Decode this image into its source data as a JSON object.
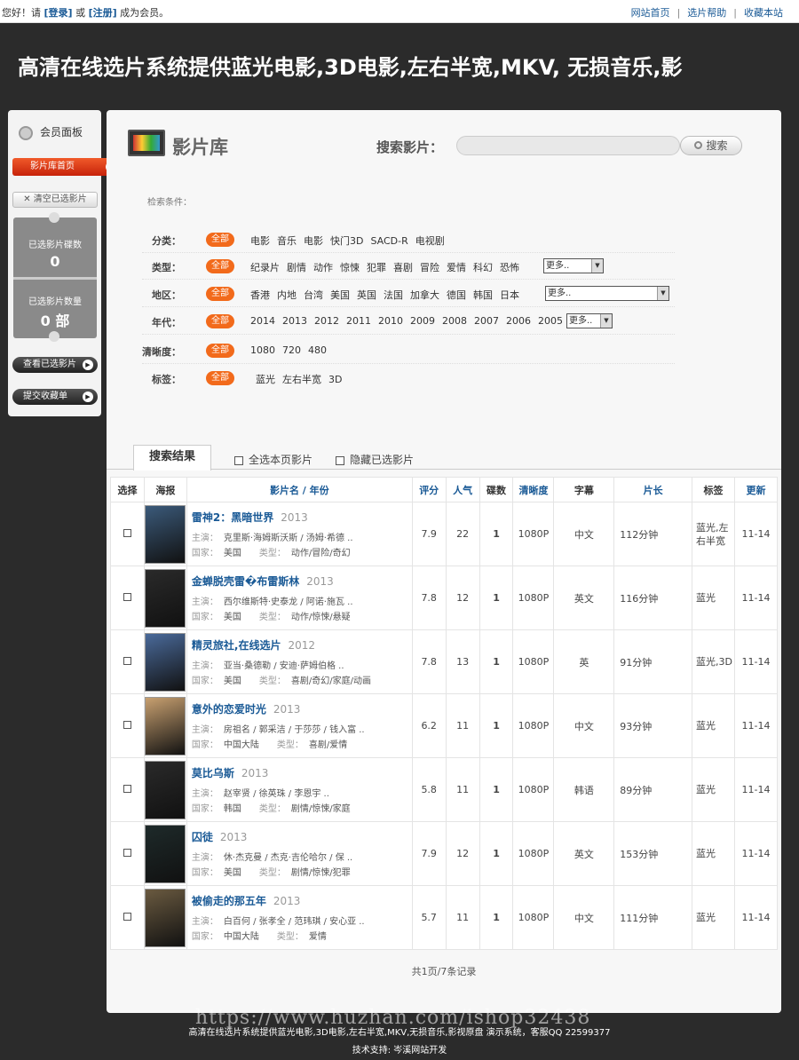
{
  "topbar": {
    "greet_pre": "您好！请",
    "login": "[登录]",
    "or": "或",
    "register": "[注册]",
    "greet_post": "成为会员。",
    "links": [
      "网站首页",
      "选片帮助",
      "收藏本站"
    ]
  },
  "headline": "高清在线选片系统提供蓝光电影,3D电影,左右半宽,MKV, 无损音乐,影",
  "sidebar": {
    "title": "会员面板",
    "home": "影片库首页",
    "clear": "清空已选影片",
    "disc_label": "已选影片碟数",
    "disc_value": "0",
    "count_label": "已选影片数量",
    "count_value": "0 部",
    "view": "查看已选影片",
    "submit": "提交收藏单"
  },
  "main": {
    "title": "影片库",
    "search_label": "搜索影片：",
    "search_placeholder": "",
    "search_btn": "搜索",
    "cond_label": "检索条件：",
    "all": "全部"
  },
  "filters": [
    {
      "label": "分类：",
      "options": [
        "电影",
        "音乐",
        "电影",
        "快门3D",
        "SACD-R",
        "电视剧"
      ],
      "more": ""
    },
    {
      "label": "类型：",
      "options": [
        "纪录片",
        "剧情",
        "动作",
        "惊悚",
        "犯罪",
        "喜剧",
        "冒险",
        "爱情",
        "科幻",
        "恐怖"
      ],
      "more": "更多.."
    },
    {
      "label": "地区：",
      "options": [
        "香港",
        "内地",
        "台湾",
        "美国",
        "英国",
        "法国",
        "加拿大",
        "德国",
        "韩国",
        "日本"
      ],
      "more": "更多.."
    },
    {
      "label": "年代：",
      "options": [
        "2014",
        "2013",
        "2012",
        "2011",
        "2010",
        "2009",
        "2008",
        "2007",
        "2006",
        "2005"
      ],
      "more": "更多.."
    },
    {
      "label": "清晰度：",
      "options": [
        "1080",
        "720",
        "480"
      ],
      "more": ""
    },
    {
      "label": "标签：",
      "options": [
        "蓝光",
        "左右半宽",
        "3D"
      ],
      "more": ""
    }
  ],
  "results": {
    "tab": "搜索结果",
    "select_all": "全选本页影片",
    "hide_selected": "隐藏已选影片"
  },
  "table": {
    "headers": [
      "选择",
      "海报",
      "影片名 / 年份",
      "评分",
      "人气",
      "碟数",
      "清晰度",
      "字幕",
      "片长",
      "标签",
      "更新"
    ],
    "actor_key": "主演：",
    "country_key": "国家：",
    "type_key": "类型：",
    "rows": [
      {
        "title": "雷神2：黑暗世界",
        "year": "2013",
        "actors": "克里斯·海姆斯沃斯 / 汤姆·希德 ..",
        "country": "美国",
        "type": "动作/冒险/奇幻",
        "score": "7.9",
        "pop": "22",
        "discs": "1",
        "res": "1080P",
        "sub": "中文",
        "len": "112分钟",
        "tags": "蓝光,左右半宽",
        "upd": "11-14",
        "color": "#3b5a7a"
      },
      {
        "title": "金蝉脱壳雷�布雷斯林",
        "year": "2013",
        "actors": "西尔维斯特·史泰龙 / 阿诺·施瓦 ..",
        "country": "美国",
        "type": "动作/惊悚/悬疑",
        "score": "7.8",
        "pop": "12",
        "discs": "1",
        "res": "1080P",
        "sub": "英文",
        "len": "116分钟",
        "tags": "蓝光",
        "upd": "11-14",
        "color": "#2a2a2a"
      },
      {
        "title": "精灵旅社,在线选片",
        "year": "2012",
        "actors": "亚当·桑德勒 / 安迪·萨姆伯格 ..",
        "country": "美国",
        "type": "喜剧/奇幻/家庭/动画",
        "score": "7.8",
        "pop": "13",
        "discs": "1",
        "res": "1080P",
        "sub": "英",
        "len": "91分钟",
        "tags": "蓝光,3D",
        "upd": "11-14",
        "color": "#4a6a9a"
      },
      {
        "title": "意外的恋爱时光",
        "year": "2013",
        "actors": "房祖名 / 郭采洁 / 于莎莎 / 钱入富 ..",
        "country": "中国大陆",
        "type": "喜剧/爱情",
        "score": "6.2",
        "pop": "11",
        "discs": "1",
        "res": "1080P",
        "sub": "中文",
        "len": "93分钟",
        "tags": "蓝光",
        "upd": "11-14",
        "color": "#c8a070"
      },
      {
        "title": "莫比乌斯",
        "year": "2013",
        "actors": "赵宰贤 / 徐英珠 / 李恩宇 ..",
        "country": "韩国",
        "type": "剧情/惊悚/家庭",
        "score": "5.8",
        "pop": "11",
        "discs": "1",
        "res": "1080P",
        "sub": "韩语",
        "len": "89分钟",
        "tags": "蓝光",
        "upd": "11-14",
        "color": "#2a2a2a"
      },
      {
        "title": "囚徒",
        "year": "2013",
        "actors": "休·杰克曼 / 杰克·吉伦哈尔 / 保 ..",
        "country": "美国",
        "type": "剧情/惊悚/犯罪",
        "score": "7.9",
        "pop": "12",
        "discs": "1",
        "res": "1080P",
        "sub": "英文",
        "len": "153分钟",
        "tags": "蓝光",
        "upd": "11-14",
        "color": "#1e2a2a"
      },
      {
        "title": "被偷走的那五年",
        "year": "2013",
        "actors": "白百何 / 张孝全 / 范玮琪 / 安心亚 ..",
        "country": "中国大陆",
        "type": "爱情",
        "score": "5.7",
        "pop": "11",
        "discs": "1",
        "res": "1080P",
        "sub": "中文",
        "len": "111分钟",
        "tags": "蓝光",
        "upd": "11-14",
        "color": "#6a5a40"
      }
    ]
  },
  "pager": "共1页/7条记录",
  "footer": {
    "line1": "高清在线选片系统提供蓝光电影,3D电影,左右半宽,MKV,无损音乐,影视原盘 演示系统，客服QQ 22599377",
    "line2": "技术支持: 岑溪网站开发",
    "watermark": "https://www.huzhan.com/ishop32438"
  }
}
